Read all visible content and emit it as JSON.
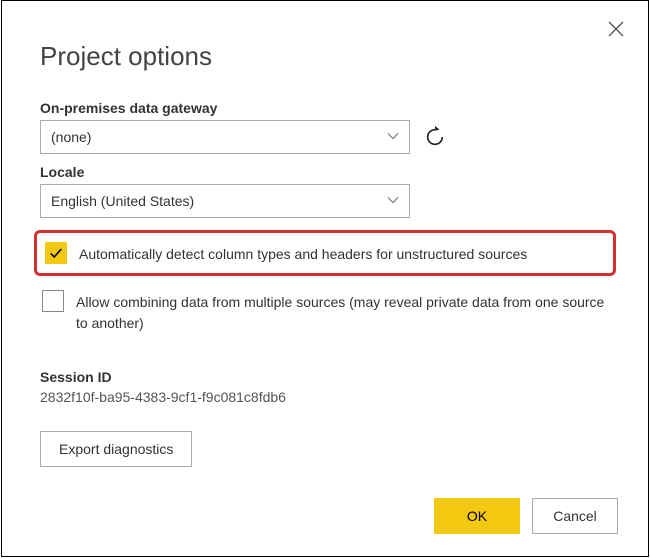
{
  "dialog": {
    "title": "Project options"
  },
  "gateway": {
    "label": "On-premises data gateway",
    "value": "(none)"
  },
  "locale": {
    "label": "Locale",
    "value": "English (United States)"
  },
  "options": {
    "autoDetectLabel": "Automatically detect column types and headers for unstructured sources",
    "autoDetectChecked": true,
    "combineLabel": "Allow combining data from multiple sources (may reveal private data from one source to another)",
    "combineChecked": false
  },
  "session": {
    "label": "Session ID",
    "value": "2832f10f-ba95-4383-9cf1-f9c081c8fdb6"
  },
  "buttons": {
    "export": "Export diagnostics",
    "ok": "OK",
    "cancel": "Cancel"
  }
}
